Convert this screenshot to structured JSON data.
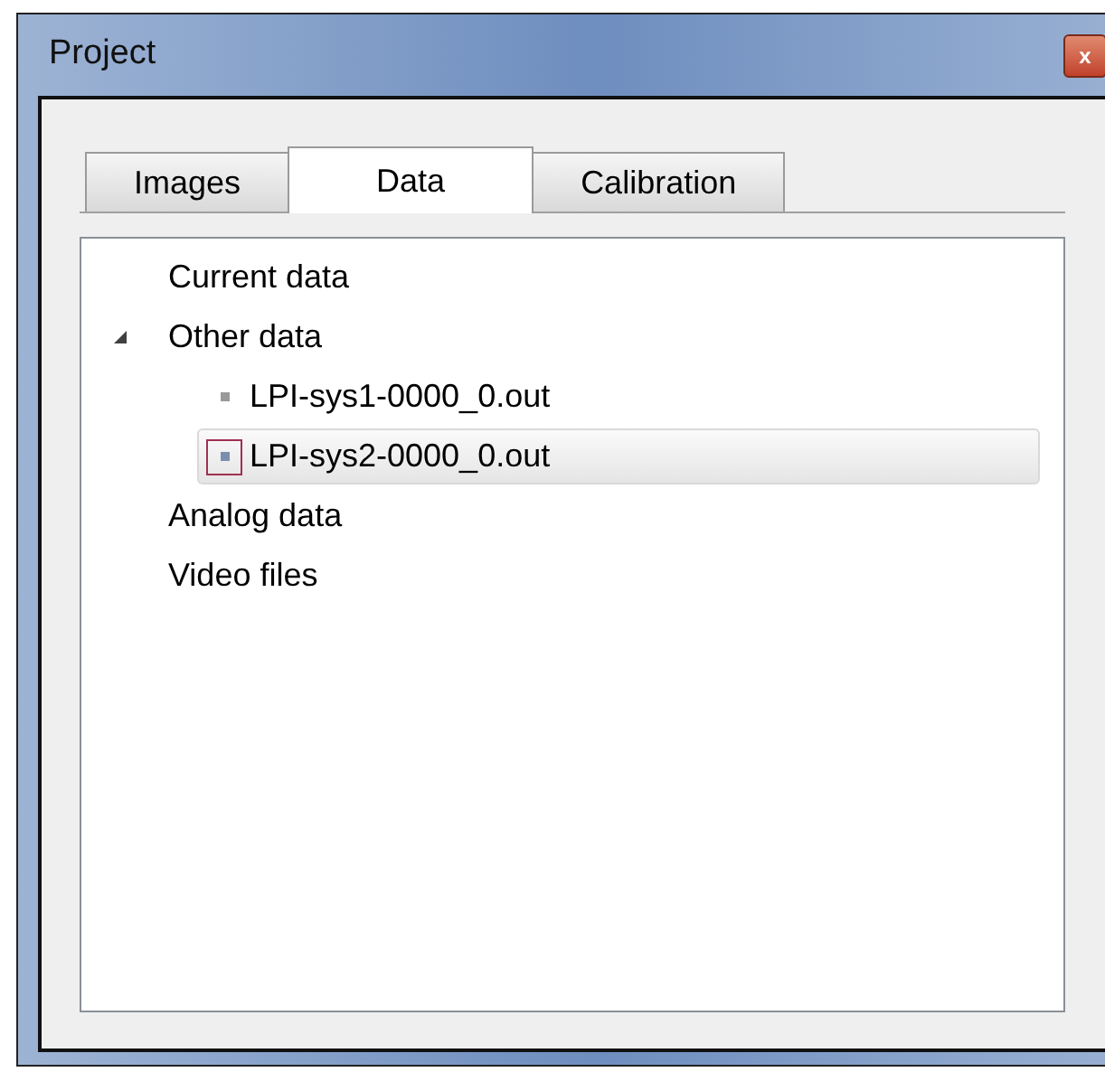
{
  "window": {
    "title": "Project",
    "close_label": "x"
  },
  "tabs": [
    {
      "label": "Images",
      "selected": false
    },
    {
      "label": "Data",
      "selected": true
    },
    {
      "label": "Calibration",
      "selected": false
    }
  ],
  "tree": [
    {
      "label": "Current data"
    },
    {
      "label": "Other data",
      "expanded": true,
      "children": [
        {
          "label": "LPI-sys1-0000_0.out",
          "selected": false
        },
        {
          "label": "LPI-sys2-0000_0.out",
          "selected": true
        }
      ]
    },
    {
      "label": "Analog data"
    },
    {
      "label": "Video files"
    }
  ]
}
